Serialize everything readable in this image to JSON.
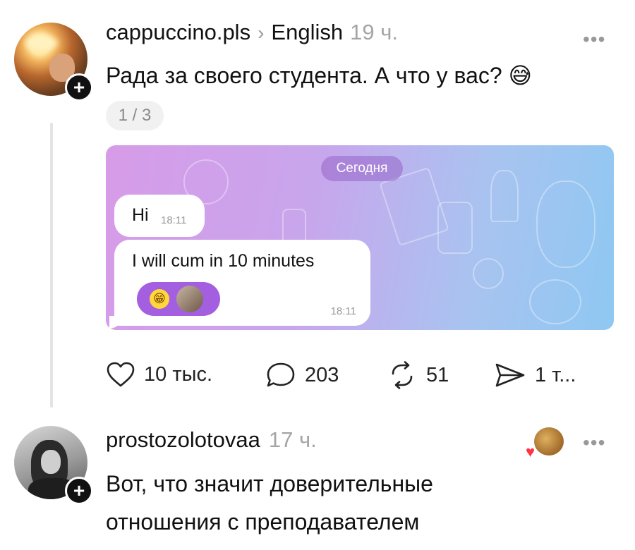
{
  "post1": {
    "username": "cappuccino.pls",
    "chevron": "›",
    "topic": "English",
    "time": "19 ч.",
    "more": "•••",
    "text": "Рада за своего студента. А что у вас?",
    "emoji": "😅",
    "image_counter": "1 / 3",
    "chat_image": {
      "date": "Сегодня",
      "messages": [
        {
          "text": "Hi",
          "time": "18:11"
        },
        {
          "text": "I will cum in 10 minutes",
          "time": "18:11"
        }
      ],
      "reaction_emoji": "😁"
    },
    "actions": {
      "likes": "10 тыс.",
      "comments": "203",
      "reposts": "51",
      "shares": "1 т..."
    }
  },
  "post2": {
    "username": "prostozolotovaa",
    "time": "17 ч.",
    "more": "•••",
    "text_line1": "Вот, что значит доверительные",
    "text_line2": "отношения с преподавателем"
  },
  "icons": {
    "plus": "+",
    "heart": "heart-icon",
    "comment": "comment-icon",
    "repost": "repost-icon",
    "share": "share-icon"
  }
}
